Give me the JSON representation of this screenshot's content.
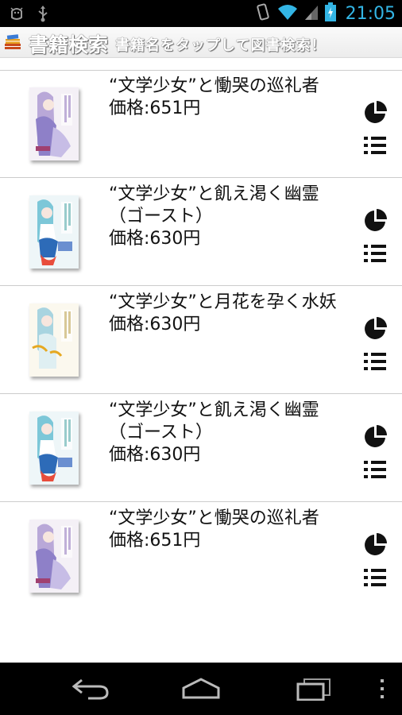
{
  "status_bar": {
    "time": "21:05",
    "icons": [
      "android-debug-icon",
      "usb-icon",
      "vibrate-icon",
      "wifi-icon",
      "signal-icon",
      "battery-charging-icon"
    ],
    "accent_color": "#33b5e5"
  },
  "app_bar": {
    "title": "書籍検索",
    "subtitle": "書籍名をタップして図書検索！",
    "icon": "books-icon"
  },
  "books": [
    {
      "title": "“文学少女”と慟哭の巡礼者",
      "price": "価格:651円",
      "cover_palette": "purple"
    },
    {
      "title": "“文学少女”と飢え渇く幽霊（ゴースト）",
      "price": "価格:630円",
      "cover_palette": "teal"
    },
    {
      "title": "“文学少女”と月花を孕く水妖",
      "price": "価格:630円",
      "cover_palette": "gold"
    },
    {
      "title": "“文学少女”と飢え渇く幽霊（ゴースト）",
      "price": "価格:630円",
      "cover_palette": "teal"
    },
    {
      "title": "“文学少女”と慟哭の巡礼者",
      "price": "価格:651円",
      "cover_palette": "purple"
    }
  ],
  "row_actions": {
    "chart_icon": "pie-chart-icon",
    "list_icon": "list-icon"
  },
  "nav_bar": {
    "buttons": [
      "back-icon",
      "home-icon",
      "recent-apps-icon",
      "overflow-menu-icon"
    ]
  }
}
